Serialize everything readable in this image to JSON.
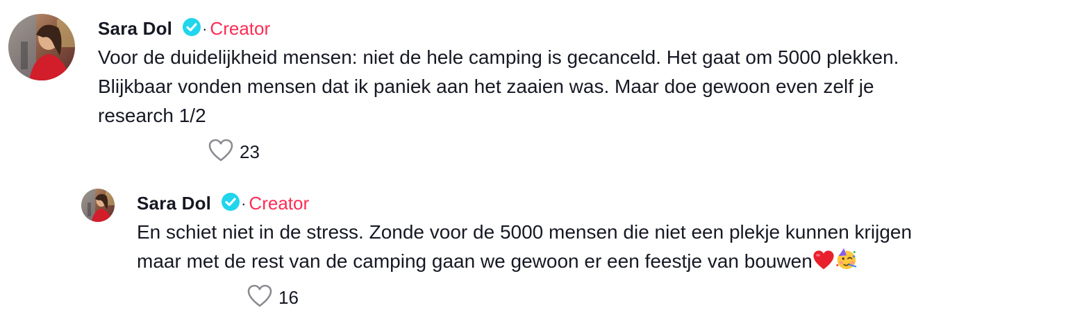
{
  "comments": [
    {
      "username": "Sara Dol",
      "separator": "·",
      "badge": "Creator",
      "lines": [
        "Voor de duidelijkheid mensen: niet de hele camping is gecanceld. Het gaat om 5000 plekken.",
        "Blijkbaar vonden mensen dat ik paniek aan het zaaien was. Maar doe gewoon even zelf je",
        "research 1/2"
      ],
      "likes": "23"
    },
    {
      "username": "Sara Dol",
      "separator": "·",
      "badge": "Creator",
      "lines": [
        "En schiet niet in de stress. Zonde voor de 5000 mensen die niet een plekje kunnen krijgen",
        "maar met de rest van de camping gaan we gewoon er een feestje van bouwen"
      ],
      "emojis": [
        "red-heart",
        "partying-face"
      ],
      "likes": "16"
    }
  ],
  "colors": {
    "creator": "#fe2c55",
    "verified": "#20d5ec",
    "text": "#161823",
    "icon": "#8a8b91"
  },
  "icons": [
    "verified-badge-icon",
    "heart-outline-icon",
    "red-heart-emoji",
    "partying-face-emoji"
  ]
}
